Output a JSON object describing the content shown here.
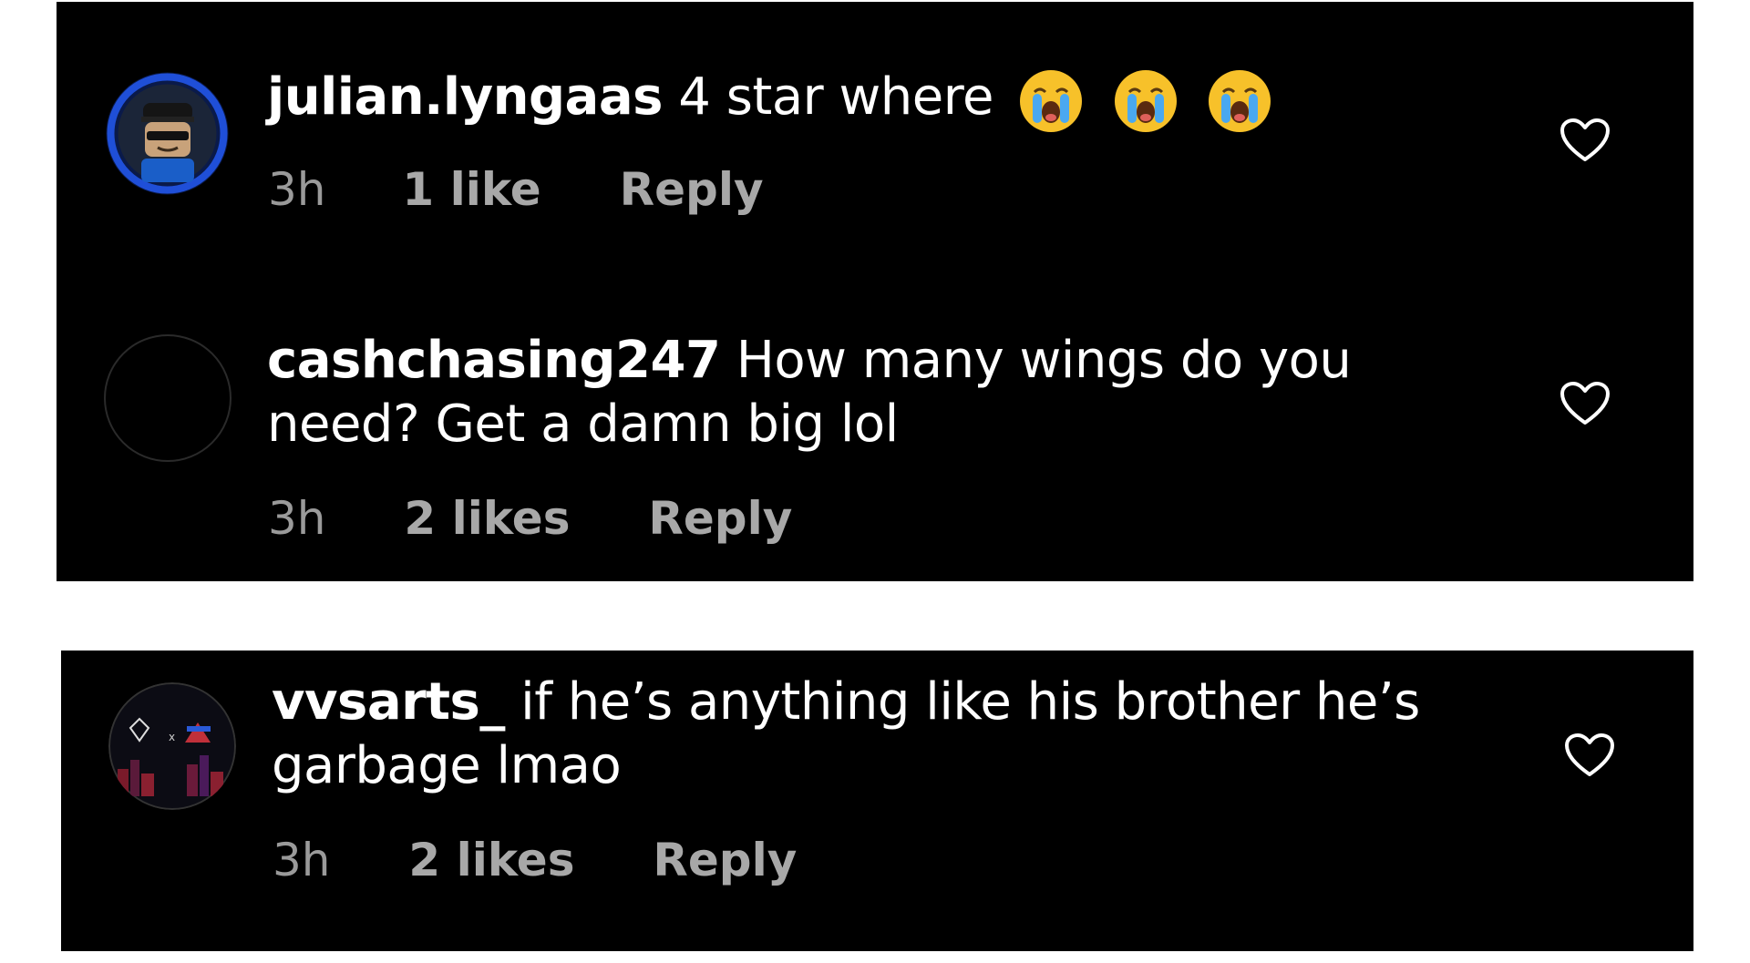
{
  "comments": [
    {
      "username": "julian.lyngaas",
      "text": "4 star where",
      "emoji": [
        "loudly-crying-face-icon",
        "loudly-crying-face-icon",
        "loudly-crying-face-icon"
      ],
      "time": "3h",
      "likes": "1 like",
      "reply": "Reply",
      "avatar_icon": "lego-minifig-avatar"
    },
    {
      "username": "cashchasing247",
      "text_line1": "How many wings do you",
      "text_line2": "need? Get a damn big lol",
      "time": "3h",
      "likes": "2 likes",
      "reply": "Reply",
      "avatar_icon": "empty-avatar"
    },
    {
      "username": "vvsarts_",
      "text_line1": "if he’s anything like his brother he’s",
      "text_line2": "garbage lmao",
      "time": "3h",
      "likes": "2 likes",
      "reply": "Reply",
      "avatar_icon": "vvs-arts-logo-avatar"
    }
  ],
  "icons": {
    "like": "heart-outline-icon"
  },
  "colors": {
    "background": "#000000",
    "text": "#ffffff",
    "meta": "#9a9a9a",
    "avatar_ring": "#1f4fd8"
  }
}
